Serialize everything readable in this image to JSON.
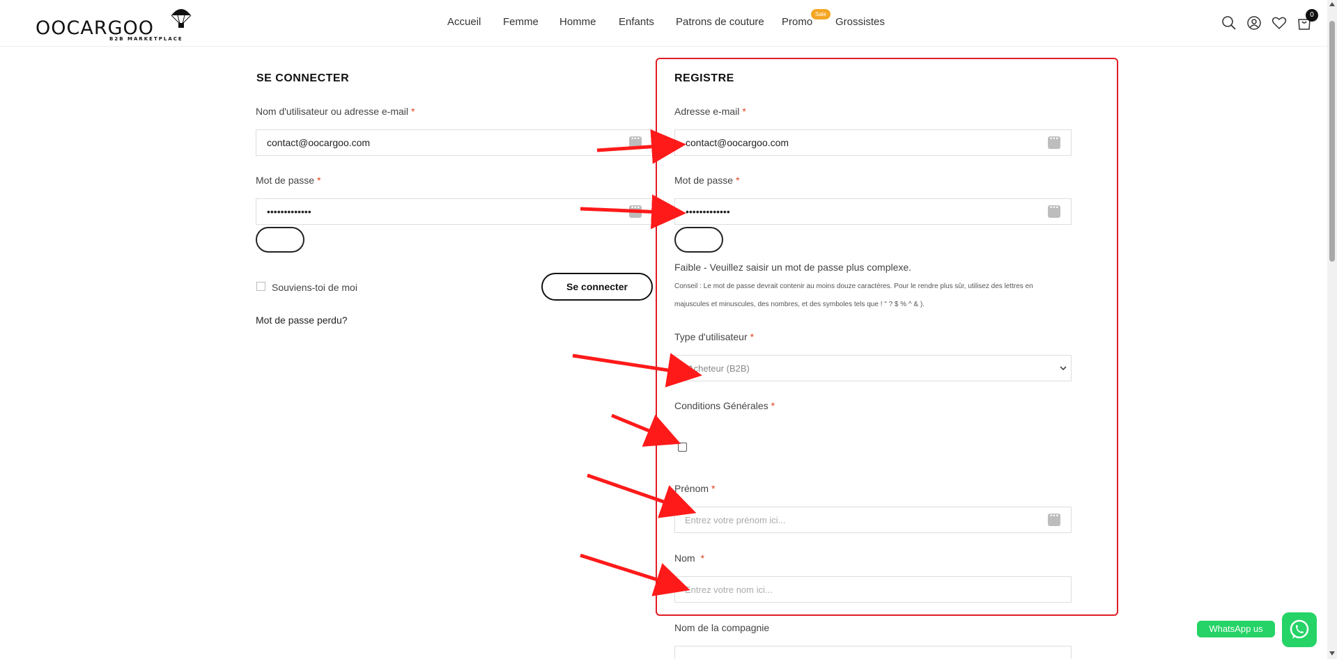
{
  "brand": {
    "name": "OOCARGOO",
    "tagline": "B2B MARKETPLACE"
  },
  "nav": {
    "items": [
      "Accueil",
      "Femme",
      "Homme",
      "Enfants",
      "Patrons de couture",
      "Promo",
      "Grossistes"
    ],
    "promo_badge": "Sale"
  },
  "header_icons": {
    "search": "search-icon",
    "account": "user-icon",
    "wishlist": "heart-icon",
    "cart": "cart-icon",
    "cart_count": "0"
  },
  "login": {
    "title": "SE CONNECTER",
    "username_label": "Nom d'utilisateur ou adresse e-mail",
    "username_value": "contact@oocargoo.com",
    "password_label": "Mot de passe",
    "password_value": "•••••••••••••",
    "remember_label": "Souviens-toi de moi",
    "submit_label": "Se connecter",
    "lost_password_label": "Mot de passe perdu?"
  },
  "register": {
    "title": "REGISTRE",
    "email_label": "Adresse e-mail",
    "email_value": "contact@oocargoo.com",
    "password_label": "Mot de passe",
    "password_value": "•••••••••••••",
    "strength_text": "Faible - Veuillez saisir un mot de passe plus complexe.",
    "hint_text": "Conseil : Le mot de passe devrait contenir au moins douze caractères. Pour le rendre plus sûr, utilisez des lettres en majuscules et minuscules, des nombres, et des symboles tels que ! \" ? $ % ^ & ).",
    "user_type_label": "Type d'utilisateur",
    "user_type_value": "Acheteur (B2B)",
    "terms_label": "Conditions Générales",
    "first_name_label": "Prénom",
    "first_name_placeholder": "Entrez votre prénom ici...",
    "last_name_label": "Nom",
    "last_name_placeholder": "Entrez votre nom ici...",
    "company_label": "Nom de la compagnie"
  },
  "required_mark": "*",
  "whatsapp": {
    "label": "WhatsApp us"
  },
  "colors": {
    "accent_red": "#e01c24",
    "required": "#e2401c",
    "sale_badge": "#f5a623",
    "whatsapp": "#25d366"
  }
}
